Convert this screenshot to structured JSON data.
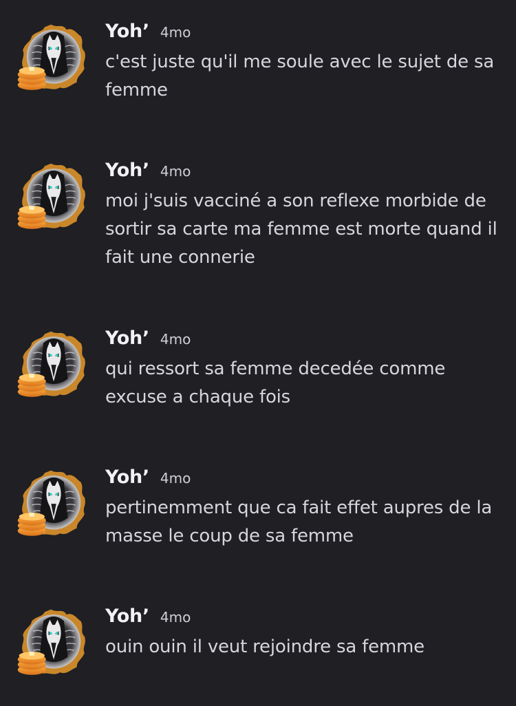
{
  "messages": [
    {
      "username": "Yoh’",
      "time": "4mo",
      "avatar_icon": "hooded-wolf-skeleton-avatar-with-pancakes",
      "text": "c'est juste qu'il me soule avec le sujet de sa femme"
    },
    {
      "username": "Yoh’",
      "time": "4mo",
      "avatar_icon": "hooded-wolf-skeleton-avatar-with-pancakes",
      "text": "moi j'suis vacciné a son reflexe morbide de sortir sa carte ma femme est morte quand il fait une connerie"
    },
    {
      "username": "Yoh’",
      "time": "4mo",
      "avatar_icon": "hooded-wolf-skeleton-avatar-with-pancakes",
      "text": "qui ressort sa femme decedée comme excuse a chaque fois"
    },
    {
      "username": "Yoh’",
      "time": "4mo",
      "avatar_icon": "hooded-wolf-skeleton-avatar-with-pancakes",
      "text": "pertinemment que ca fait effet aupres de la masse le coup de sa femme"
    },
    {
      "username": "Yoh’",
      "time": "4mo",
      "avatar_icon": "hooded-wolf-skeleton-avatar-with-pancakes",
      "text": "ouin ouin il veut rejoindre sa femme"
    }
  ],
  "colors": {
    "background": "#1f1f24",
    "username": "#f2f2f5",
    "message_text": "#d6d6dc",
    "timestamp": "#d0d0d6",
    "avatar_accent": "#e89a2c"
  }
}
